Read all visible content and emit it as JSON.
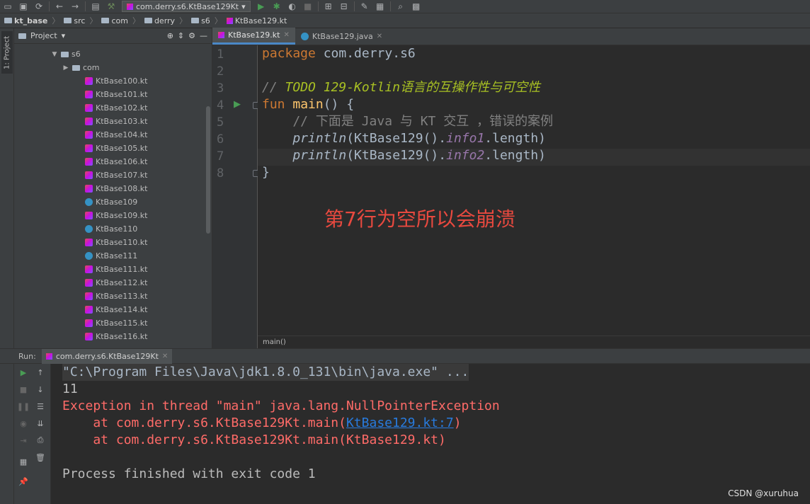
{
  "toolbar": {
    "run_config": "com.derry.s6.KtBase129Kt"
  },
  "navbar": {
    "crumbs": [
      "kt_base",
      "src",
      "com",
      "derry",
      "s6",
      "KtBase129.kt"
    ]
  },
  "left_strip": {
    "label": "1: Project"
  },
  "project": {
    "title": "Project",
    "tree": [
      {
        "label": "s6",
        "kind": "folder",
        "indent": 1,
        "expanded": true
      },
      {
        "label": "com",
        "kind": "folder",
        "indent": 2,
        "expanded": false
      },
      {
        "label": "KtBase100.kt",
        "kind": "kt",
        "indent": 3
      },
      {
        "label": "KtBase101.kt",
        "kind": "kt",
        "indent": 3
      },
      {
        "label": "KtBase102.kt",
        "kind": "kt",
        "indent": 3
      },
      {
        "label": "KtBase103.kt",
        "kind": "kt",
        "indent": 3
      },
      {
        "label": "KtBase104.kt",
        "kind": "kt",
        "indent": 3
      },
      {
        "label": "KtBase105.kt",
        "kind": "kt",
        "indent": 3
      },
      {
        "label": "KtBase106.kt",
        "kind": "kt",
        "indent": 3
      },
      {
        "label": "KtBase107.kt",
        "kind": "kt",
        "indent": 3
      },
      {
        "label": "KtBase108.kt",
        "kind": "kt",
        "indent": 3
      },
      {
        "label": "KtBase109",
        "kind": "class",
        "indent": 3
      },
      {
        "label": "KtBase109.kt",
        "kind": "kt",
        "indent": 3
      },
      {
        "label": "KtBase110",
        "kind": "class",
        "indent": 3
      },
      {
        "label": "KtBase110.kt",
        "kind": "kt",
        "indent": 3
      },
      {
        "label": "KtBase111",
        "kind": "class",
        "indent": 3
      },
      {
        "label": "KtBase111.kt",
        "kind": "kt",
        "indent": 3
      },
      {
        "label": "KtBase112.kt",
        "kind": "kt",
        "indent": 3
      },
      {
        "label": "KtBase113.kt",
        "kind": "kt",
        "indent": 3
      },
      {
        "label": "KtBase114.kt",
        "kind": "kt",
        "indent": 3
      },
      {
        "label": "KtBase115.kt",
        "kind": "kt",
        "indent": 3
      },
      {
        "label": "KtBase116.kt",
        "kind": "kt",
        "indent": 3
      }
    ]
  },
  "editor": {
    "tabs": [
      {
        "label": "KtBase129.kt",
        "active": true
      },
      {
        "label": "KtBase129.java",
        "active": false
      }
    ],
    "line_numbers": [
      "1",
      "2",
      "3",
      "4",
      "5",
      "6",
      "7",
      "8"
    ],
    "code": {
      "l1_kw": "package",
      "l1_rest": " com.derry.s6",
      "l3_cmt": "// ",
      "l3_todo": "TODO 129-Kotlin语言的互操作性与可空性",
      "l4_kw": "fun",
      "l4_fn": " main",
      "l4_rest": "() {",
      "l5_cmt": "    // 下面是 Java 与 KT 交互 ，错误的案例",
      "l6_fn": "    println",
      "l6_mid": "(KtBase129().",
      "l6_prop": "info1",
      "l6_end": ".length)",
      "l7_fn": "    println",
      "l7_mid": "(KtBase129().",
      "l7_prop": "info2",
      "l7_end": ".length)",
      "l8": "}"
    },
    "annotation": "第7行为空所以会崩溃",
    "breadcrumb": "main()"
  },
  "run": {
    "label": "Run:",
    "tab": "com.derry.s6.KtBase129Kt",
    "console": {
      "cmd": "\"C:\\Program Files\\Java\\jdk1.8.0_131\\bin\\java.exe\" ...",
      "out1": "11",
      "err1": "Exception in thread \"main\" java.lang.NullPointerException",
      "err2_pre": "    at com.derry.s6.KtBase129Kt.main(",
      "err2_link": "KtBase129.kt:7",
      "err2_post": ")",
      "err3": "    at com.derry.s6.KtBase129Kt.main(KtBase129.kt)",
      "finish": "Process finished with exit code 1"
    }
  },
  "watermark": "CSDN @xuruhua"
}
